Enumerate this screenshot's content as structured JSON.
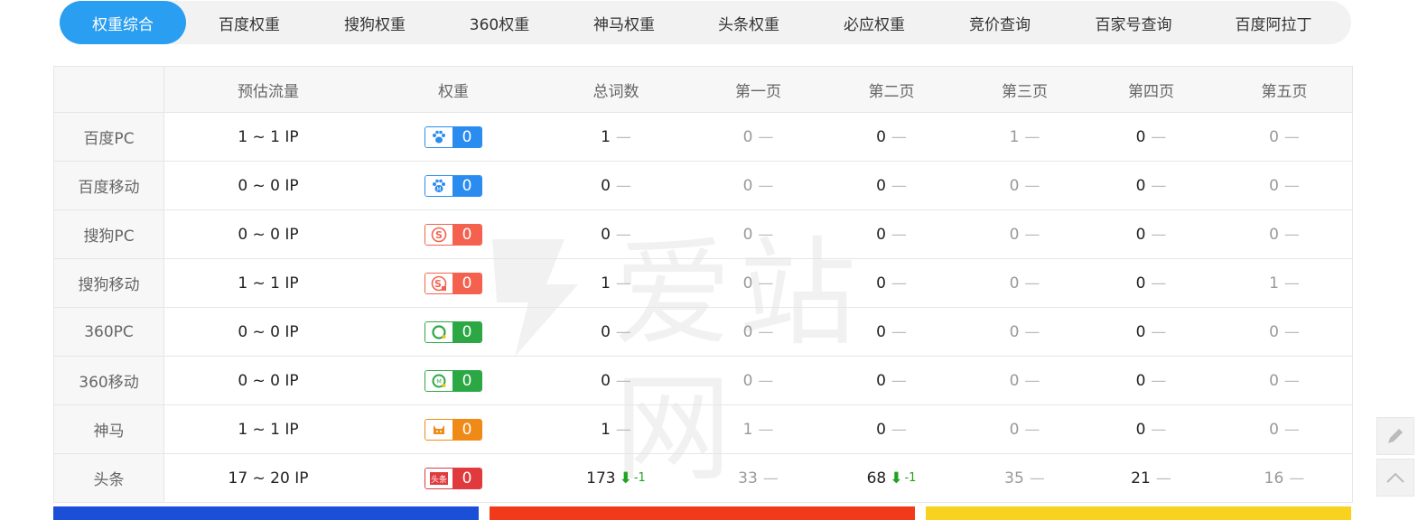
{
  "tabs": [
    {
      "label": "权重综合",
      "active": true
    },
    {
      "label": "百度权重"
    },
    {
      "label": "搜狗权重"
    },
    {
      "label": "360权重"
    },
    {
      "label": "神马权重"
    },
    {
      "label": "头条权重"
    },
    {
      "label": "必应权重"
    },
    {
      "label": "竞价查询"
    },
    {
      "label": "百家号查询"
    },
    {
      "label": "百度阿拉丁"
    }
  ],
  "table": {
    "headers": [
      "",
      "预估流量",
      "权重",
      "总词数",
      "第一页",
      "第二页",
      "第三页",
      "第四页",
      "第五页"
    ],
    "rows": [
      {
        "engine": "百度PC",
        "traffic": "1 ~ 1 IP",
        "icon": "baidu-paw-icon",
        "color": "#2b8cf0",
        "weight": "0",
        "total": "1",
        "p1": "0",
        "p2": "0",
        "p3": "1",
        "p4": "0",
        "p5": "0"
      },
      {
        "engine": "百度移动",
        "traffic": "0 ~ 0 IP",
        "icon": "baidu-mobile-paw-icon",
        "color": "#2b8cf0",
        "weight": "0",
        "total": "0",
        "p1": "0",
        "p2": "0",
        "p3": "0",
        "p4": "0",
        "p5": "0"
      },
      {
        "engine": "搜狗PC",
        "traffic": "0 ~ 0 IP",
        "icon": "sogou-icon",
        "color": "#f4624f",
        "weight": "0",
        "total": "0",
        "p1": "0",
        "p2": "0",
        "p3": "0",
        "p4": "0",
        "p5": "0"
      },
      {
        "engine": "搜狗移动",
        "traffic": "1 ~ 1 IP",
        "icon": "sogou-mobile-icon",
        "color": "#f4624f",
        "weight": "0",
        "total": "1",
        "p1": "0",
        "p2": "0",
        "p3": "0",
        "p4": "0",
        "p5": "1"
      },
      {
        "engine": "360PC",
        "traffic": "0 ~ 0 IP",
        "icon": "360-icon",
        "color": "#2ba844",
        "weight": "0",
        "total": "0",
        "p1": "0",
        "p2": "0",
        "p3": "0",
        "p4": "0",
        "p5": "0"
      },
      {
        "engine": "360移动",
        "traffic": "0 ~ 0 IP",
        "icon": "360-mobile-icon",
        "color": "#2ba844",
        "weight": "0",
        "total": "0",
        "p1": "0",
        "p2": "0",
        "p3": "0",
        "p4": "0",
        "p5": "0"
      },
      {
        "engine": "神马",
        "traffic": "1 ~ 1 IP",
        "icon": "shenma-icon",
        "color": "#f08a16",
        "weight": "0",
        "total": "1",
        "p1": "1",
        "p2": "0",
        "p3": "0",
        "p4": "0",
        "p5": "0"
      },
      {
        "engine": "头条",
        "traffic": "17 ~ 20 IP",
        "icon": "toutiao-icon",
        "color": "#e0393e",
        "weight": "0",
        "total": "173",
        "total_delta": "-1",
        "p1": "33",
        "p2": "68",
        "p2_delta": "-1",
        "p3": "35",
        "p4": "21",
        "p5": "16"
      }
    ]
  },
  "watermark": {
    "text": "爱站网"
  },
  "icon_labels": {
    "toutiao": "头条"
  }
}
